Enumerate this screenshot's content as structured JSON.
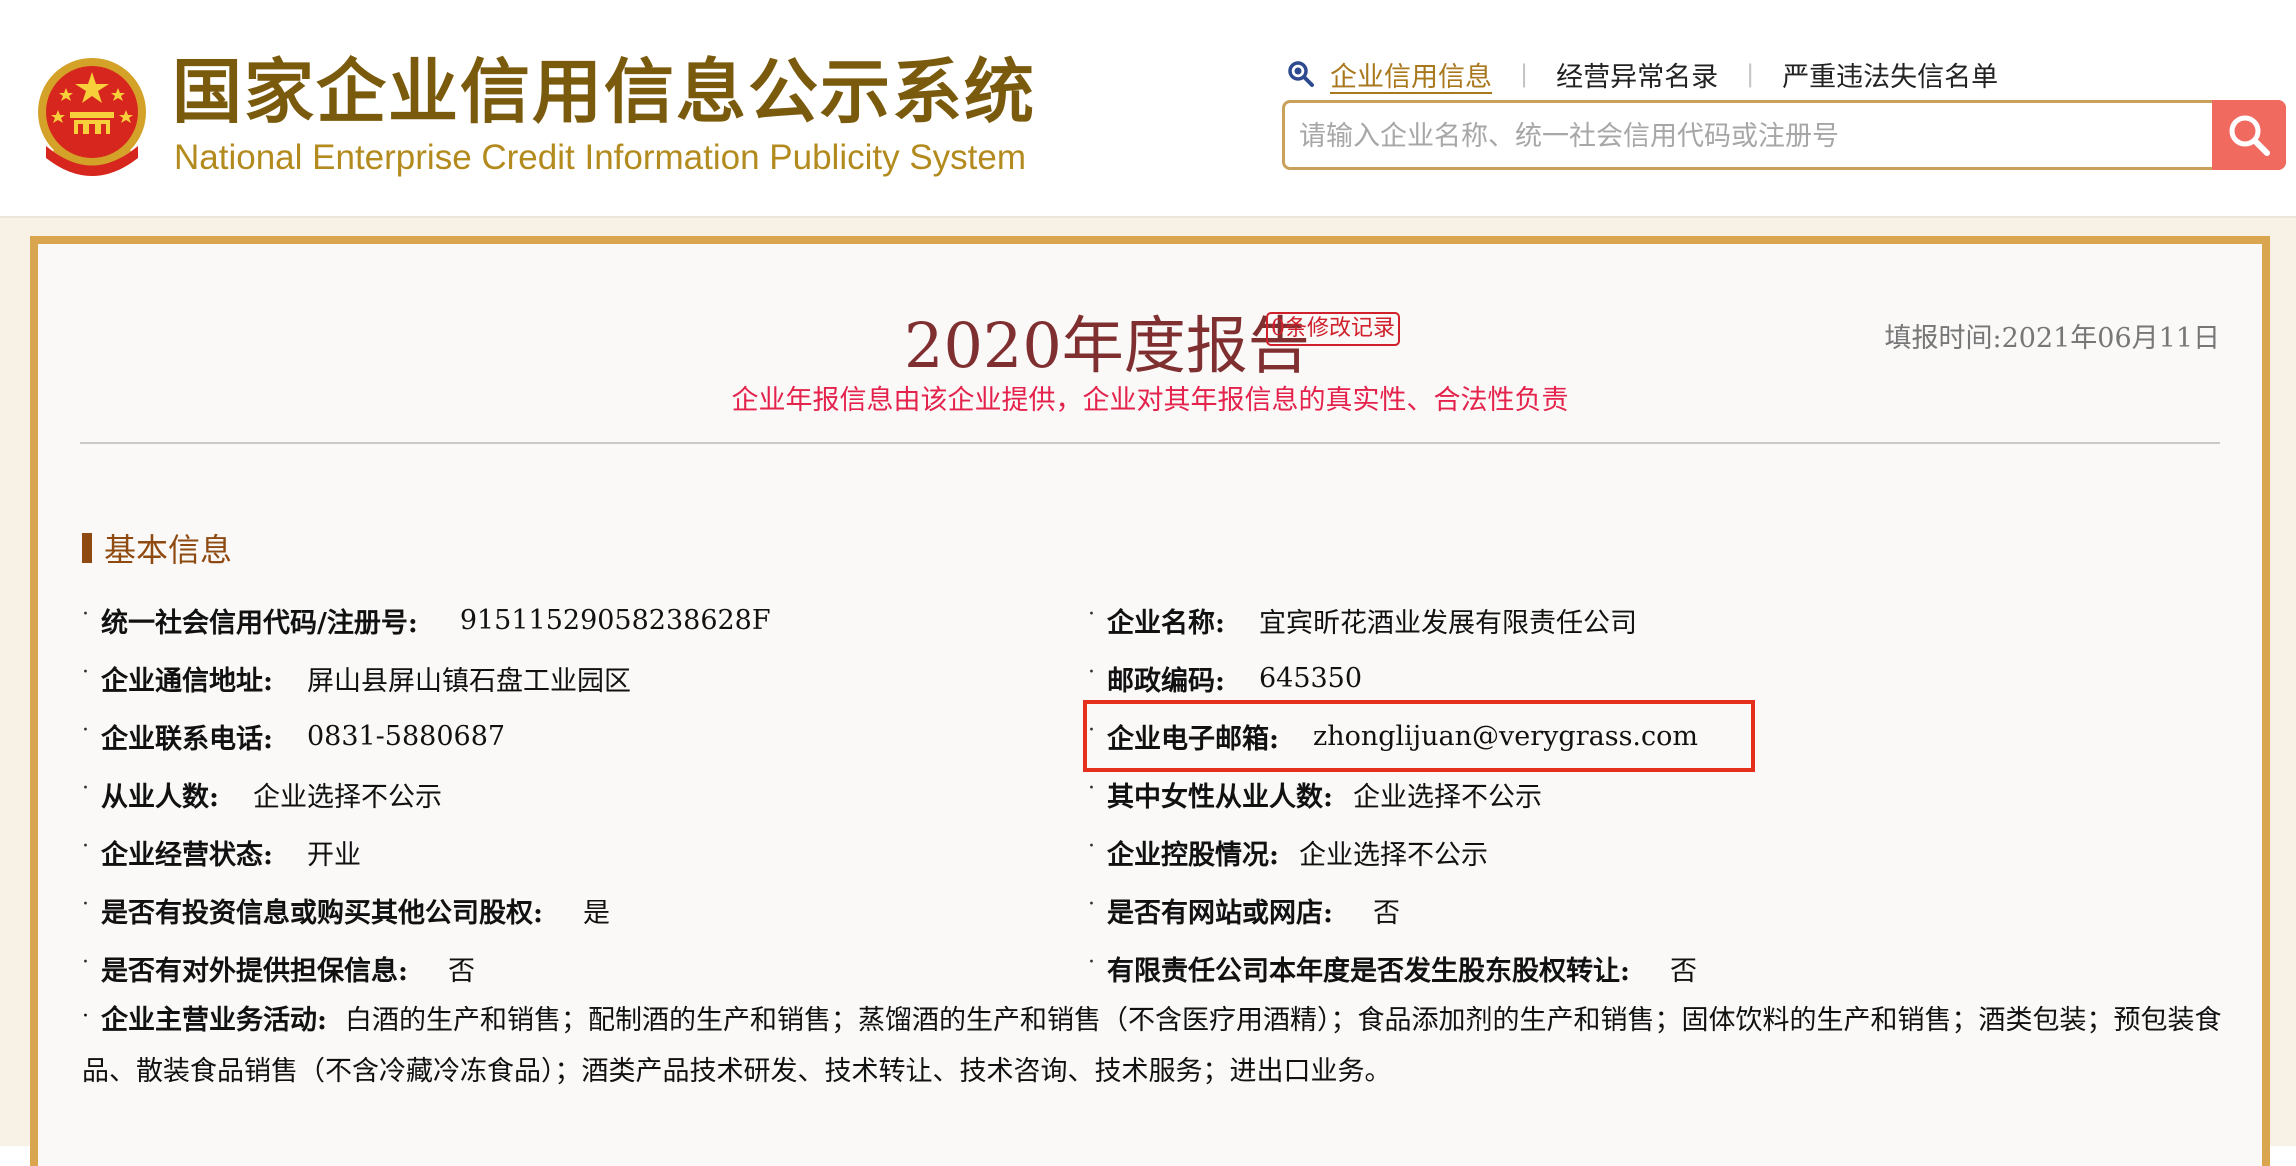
{
  "header": {
    "title_cn": "国家企业信用信息公示系统",
    "title_en": "National Enterprise Credit Information Publicity System",
    "nav": [
      {
        "label": "企业信用信息"
      },
      {
        "label": "经营异常名录"
      },
      {
        "label": "严重违法失信名单"
      }
    ],
    "search": {
      "placeholder": "请输入企业名称、统一社会信用代码或注册号",
      "value": ""
    }
  },
  "report": {
    "title": "2020年度报告",
    "revision_badge": "0条修改记录",
    "fill_time": "填报时间:2021年06月11日",
    "disclaimer": "企业年报信息由该企业提供，企业对其年报信息的真实性、合法性负责",
    "section_title": "基本信息",
    "fields": {
      "credit_code": {
        "label": "统一社会信用代码/注册号:",
        "value": "91511529058238628F"
      },
      "company_name": {
        "label": "企业名称:",
        "value": "宜宾昕花酒业发展有限责任公司"
      },
      "address": {
        "label": "企业通信地址:",
        "value": "屏山县屏山镇石盘工业园区"
      },
      "postal_code": {
        "label": "邮政编码:",
        "value": "645350"
      },
      "phone": {
        "label": "企业联系电话:",
        "value": "0831-5880687"
      },
      "email": {
        "label": "企业电子邮箱:",
        "value": "zhonglijuan@verygrass.com"
      },
      "employees": {
        "label": "从业人数:",
        "value": "企业选择不公示"
      },
      "female_employees": {
        "label": "其中女性从业人数:",
        "value": "企业选择不公示"
      },
      "status": {
        "label": "企业经营状态:",
        "value": "开业"
      },
      "holding": {
        "label": "企业控股情况:",
        "value": "企业选择不公示"
      },
      "investment": {
        "label": "是否有投资信息或购买其他公司股权:",
        "value": "是"
      },
      "website": {
        "label": "是否有网站或网店:",
        "value": "否"
      },
      "guarantee": {
        "label": "是否有对外提供担保信息:",
        "value": "否"
      },
      "equity_transfer": {
        "label": "有限责任公司本年度是否发生股东股权转让:",
        "value": "否"
      },
      "business_scope": {
        "label": "企业主营业务活动:",
        "value": "白酒的生产和销售；配制酒的生产和销售；蒸馏酒的生产和销售（不含医疗用酒精）；食品添加剂的生产和销售；固体饮料的生产和销售；酒类包装；预包装食品、散装食品销售（不含冷藏冷冻食品）；酒类产品技术研发、技术转让、技术咨询、技术服务；进出口业务。"
      }
    }
  },
  "colors": {
    "brand_gold": "#7a5a0c",
    "panel_border": "#d9a54e",
    "search_button": "#f06a60",
    "disclaimer_red": "#e4224c",
    "highlight_red": "#e5301e"
  },
  "icons": [
    "national-emblem-icon",
    "magnifier-icon",
    "search-icon"
  ]
}
